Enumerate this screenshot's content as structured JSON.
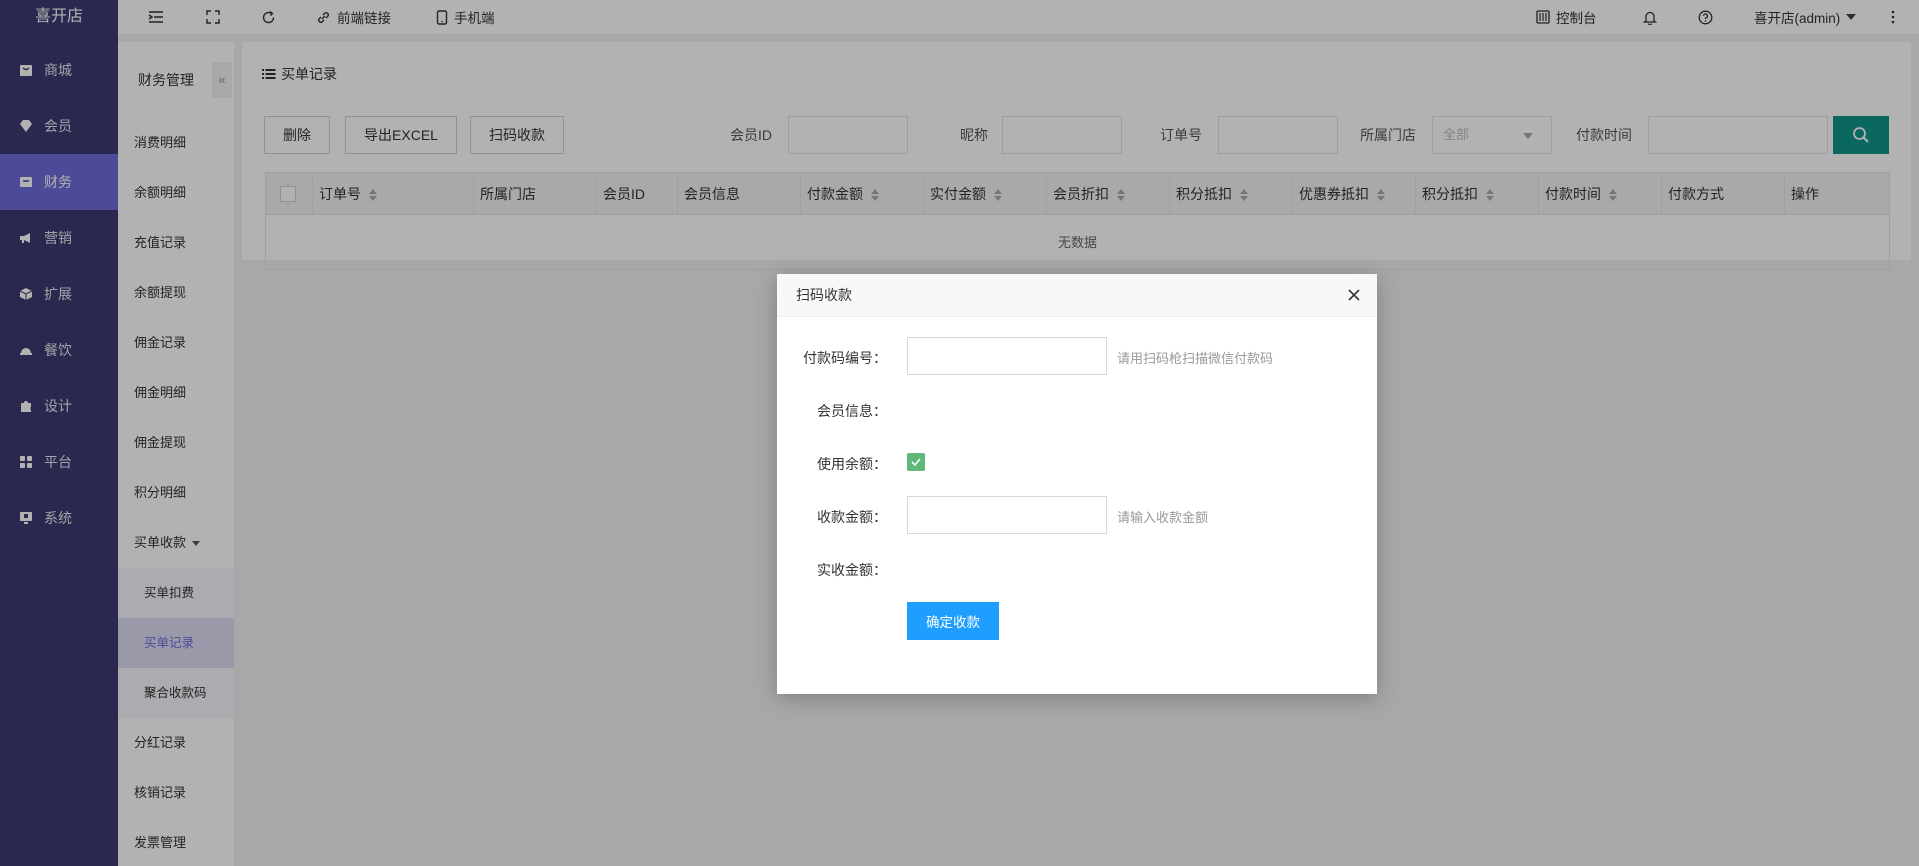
{
  "brand": "喜开店",
  "sidebar": {
    "items": [
      {
        "label": "商城",
        "icon": "shop-icon"
      },
      {
        "label": "会员",
        "icon": "gem-icon"
      },
      {
        "label": "财务",
        "icon": "wallet-icon",
        "active": true
      },
      {
        "label": "营销",
        "icon": "megaphone-icon"
      },
      {
        "label": "扩展",
        "icon": "cube-icon"
      },
      {
        "label": "餐饮",
        "icon": "food-icon"
      },
      {
        "label": "设计",
        "icon": "puzzle-icon"
      },
      {
        "label": "平台",
        "icon": "grid-icon"
      },
      {
        "label": "系统",
        "icon": "monitor-icon"
      }
    ]
  },
  "subnav": {
    "title": "财务管理",
    "collapse": "«",
    "items": [
      {
        "label": "消费明细"
      },
      {
        "label": "余额明细"
      },
      {
        "label": "充值记录"
      },
      {
        "label": "余额提现"
      },
      {
        "label": "佣金记录"
      },
      {
        "label": "佣金明细"
      },
      {
        "label": "佣金提现"
      },
      {
        "label": "积分明细"
      },
      {
        "label": "买单收款"
      },
      {
        "label": "买单扣费",
        "child": true
      },
      {
        "label": "买单记录",
        "child": true,
        "active": true
      },
      {
        "label": "聚合收款码",
        "child": true
      },
      {
        "label": "分红记录"
      },
      {
        "label": "核销记录"
      },
      {
        "label": "发票管理"
      }
    ]
  },
  "header": {
    "frontend_link": "前端链接",
    "mobile": "手机端",
    "console": "控制台",
    "user": "喜开店(admin)"
  },
  "panel": {
    "title": "买单记录",
    "buttons": {
      "delete": "删除",
      "export": "导出EXCEL",
      "scan": "扫码收款"
    },
    "filters": {
      "member_id": "会员ID",
      "nickname": "昵称",
      "order_no": "订单号",
      "store": "所属门店",
      "store_value": "全部",
      "pay_time": "付款时间"
    }
  },
  "table": {
    "columns": [
      "订单号",
      "所属门店",
      "会员ID",
      "会员信息",
      "付款金额",
      "实付金额",
      "会员折扣",
      "积分抵扣",
      "优惠券抵扣",
      "积分抵扣",
      "付款时间",
      "付款方式",
      "操作"
    ],
    "empty": "无数据"
  },
  "dialog": {
    "title": "扫码收款",
    "code_label": "付款码编号：",
    "code_hint": "请用扫码枪扫描微信付款码",
    "member_label": "会员信息：",
    "balance_label": "使用余额：",
    "balance_checked": true,
    "amount_label": "收款金额：",
    "amount_hint": "请输入收款金额",
    "actual_label": "实收金额：",
    "confirm": "确定收款"
  },
  "colors": {
    "sidebar_bg": "#3d3a72",
    "sidebar_active": "#6f6bd9",
    "search_btn": "#0f9688",
    "confirm_btn": "#1e9fff",
    "checkbox": "#5fb878"
  }
}
